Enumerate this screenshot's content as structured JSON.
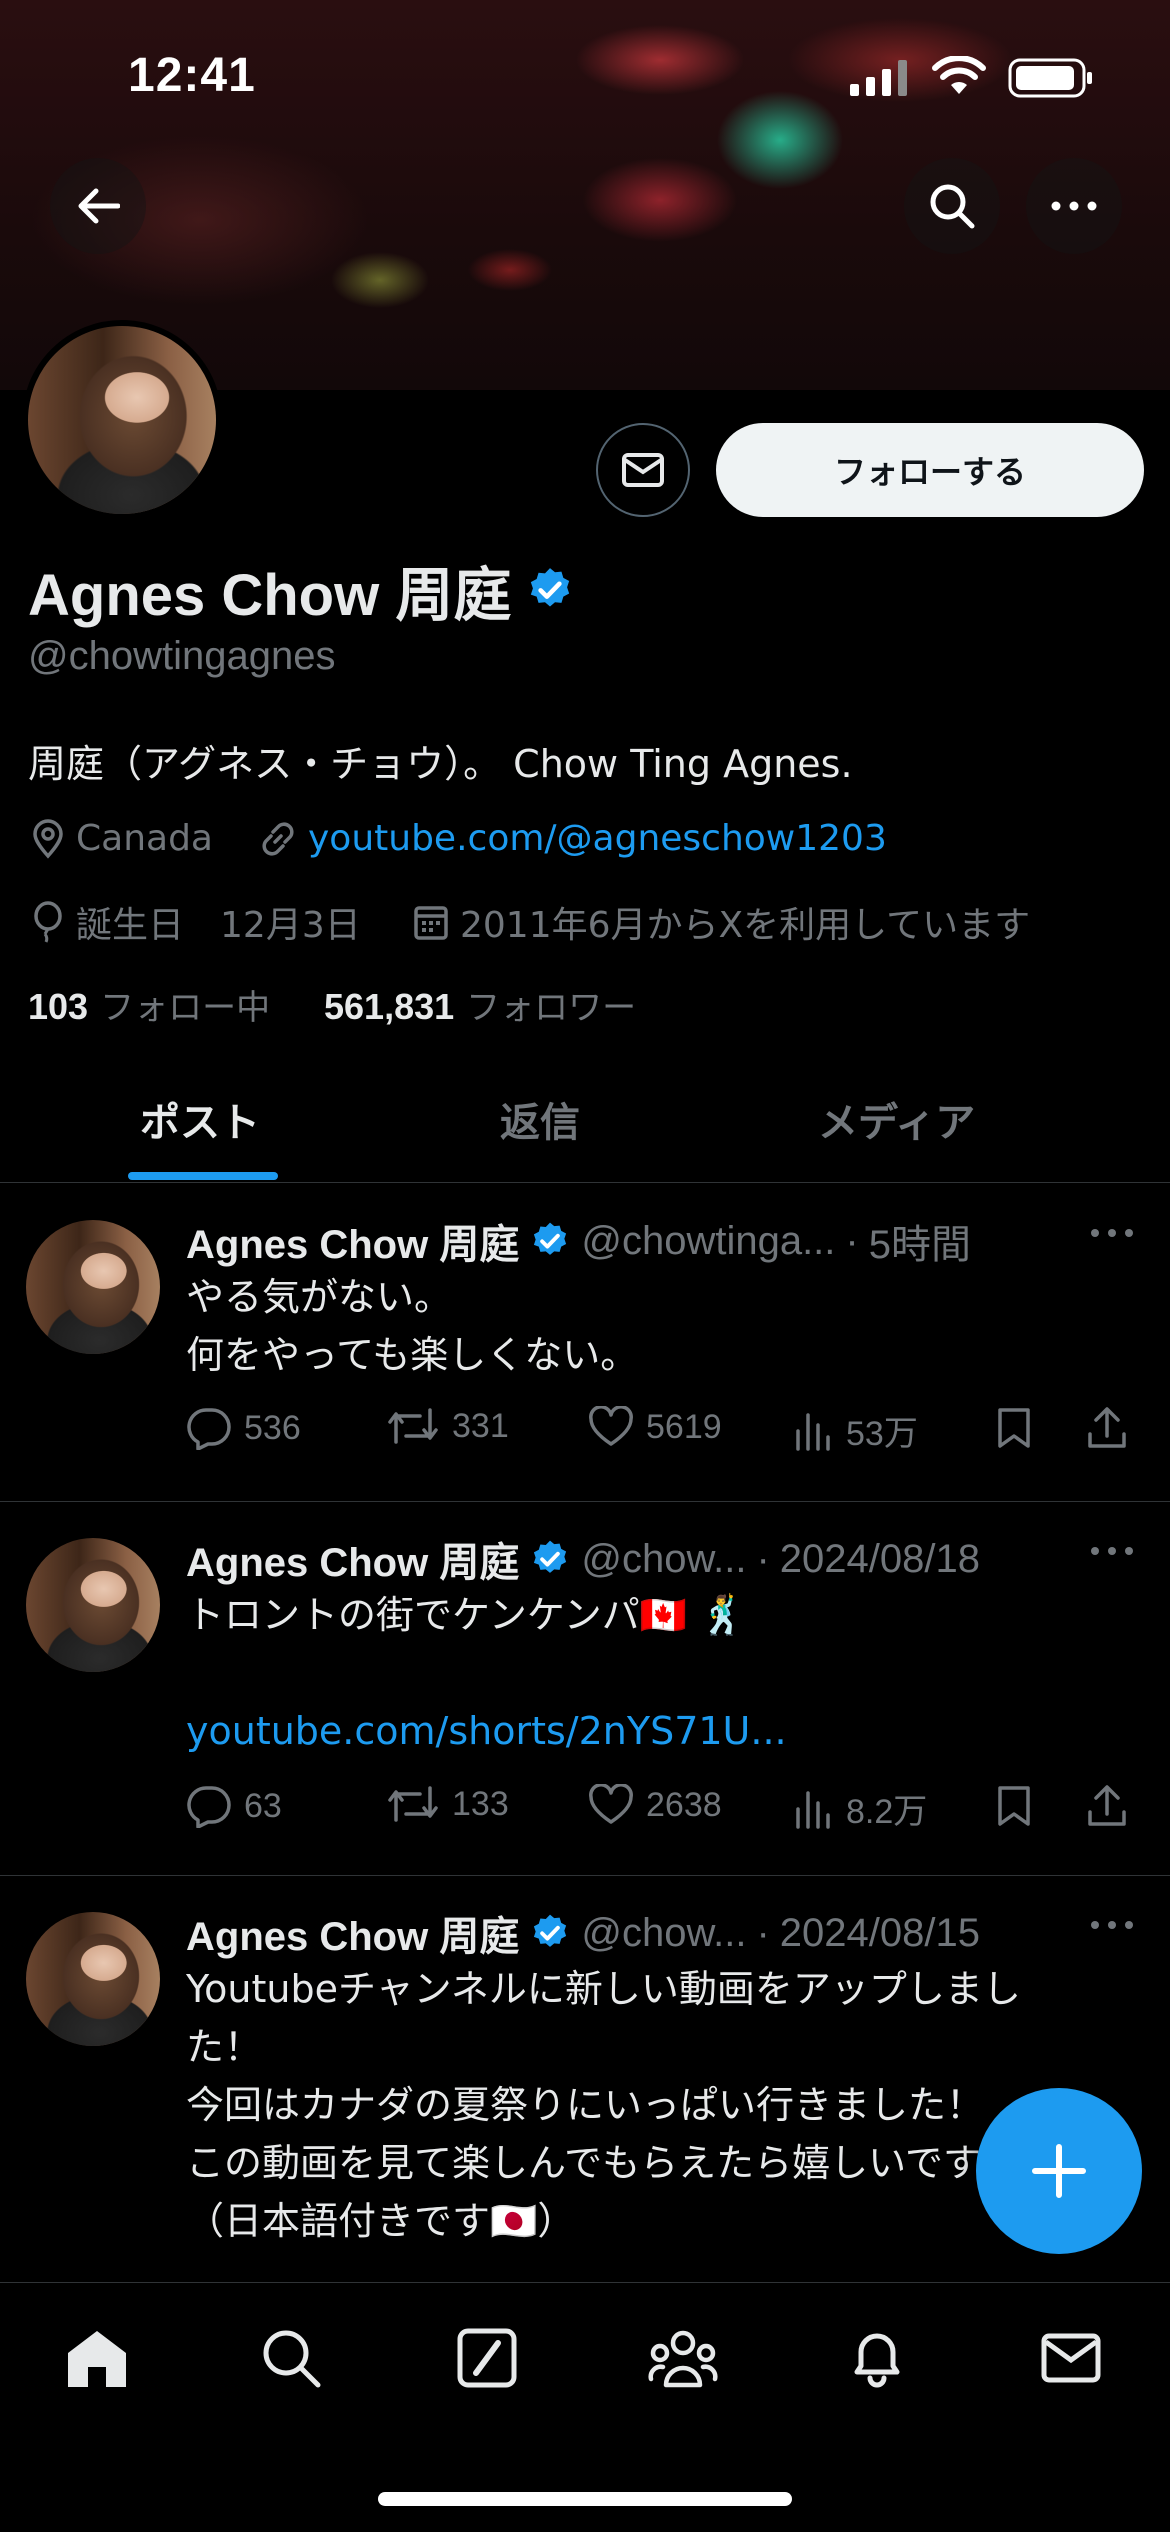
{
  "status_bar": {
    "time": "12:41"
  },
  "profile": {
    "name": "Agnes Chow 周庭",
    "handle": "@chowtingagnes",
    "bio": "周庭（アグネス・チョウ）。 Chow Ting Agnes.",
    "location": "Canada",
    "website": "youtube.com/@agneschow1203",
    "birthday_label": "誕生日",
    "birthday": "12月3日",
    "joined": "2011年6月からXを利用しています",
    "following_count": "103",
    "following_label": "フォロー中",
    "followers_count": "561,831",
    "followers_label": "フォロワー",
    "follow_button": "フォローする"
  },
  "tabs": [
    {
      "label": "ポスト",
      "active": true
    },
    {
      "label": "返信",
      "active": false
    },
    {
      "label": "メディア",
      "active": false
    }
  ],
  "posts": [
    {
      "name": "Agnes Chow 周庭",
      "handle": "@chowtinga...",
      "sep": "·",
      "time": "5時間",
      "lines": [
        "やる気がない。",
        "何をやっても楽しくない。"
      ],
      "replies": "536",
      "reposts": "331",
      "likes": "5619",
      "views": "53万"
    },
    {
      "name": "Agnes Chow 周庭",
      "handle": "@chow...",
      "sep": "·",
      "time": "2024/08/18",
      "lines": [
        "トロントの街でケンケンパ🇨🇦 🕺"
      ],
      "link": "youtube.com/shorts/2nYS71U...",
      "replies": "63",
      "reposts": "133",
      "likes": "2638",
      "views": "8.2万"
    },
    {
      "name": "Agnes Chow 周庭",
      "handle": "@chow...",
      "sep": "·",
      "time": "2024/08/15",
      "lines": [
        "Youtubeチャンネルに新しい動画をアップしまし",
        "た！",
        "今回はカナダの夏祭りにいっぱい行きました！",
        "この動画を見て楽しんでもらえたら嬉しいです",
        "（日本語付きです🇯🇵）"
      ]
    }
  ],
  "colors": {
    "accent": "#1d9bf0",
    "muted": "#71767b",
    "text": "#e7e9ea",
    "bg": "#000000"
  }
}
